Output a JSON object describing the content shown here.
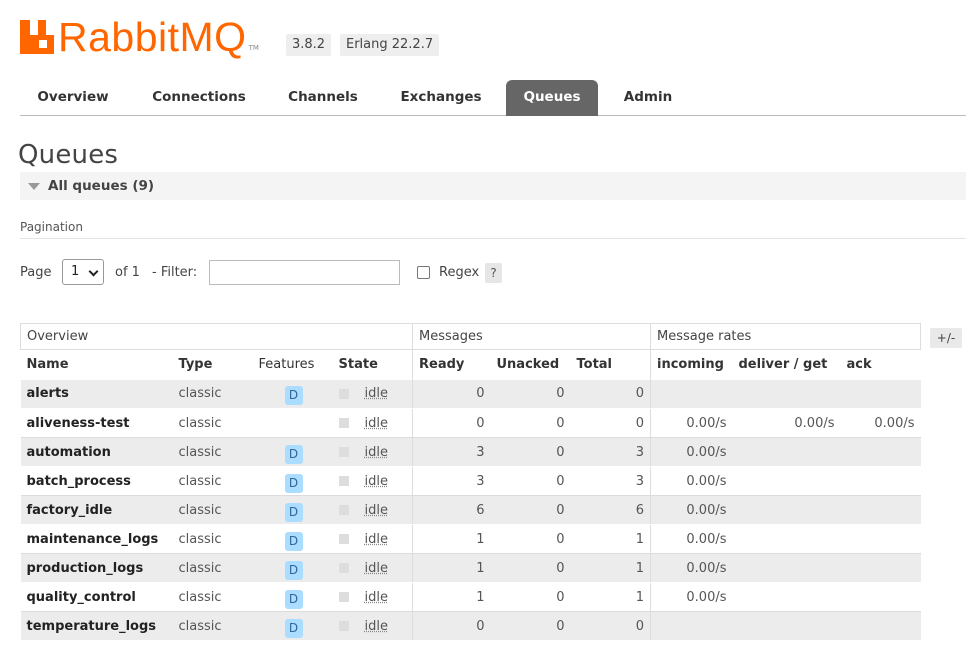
{
  "header": {
    "logo_text": "RabbitMQ",
    "logo_tm": "TM",
    "version": "3.8.2",
    "erlang": "Erlang 22.2.7"
  },
  "nav": {
    "tabs": [
      {
        "label": "Overview",
        "active": false
      },
      {
        "label": "Connections",
        "active": false
      },
      {
        "label": "Channels",
        "active": false
      },
      {
        "label": "Exchanges",
        "active": false
      },
      {
        "label": "Queues",
        "active": true
      },
      {
        "label": "Admin",
        "active": false
      }
    ]
  },
  "page": {
    "title": "Queues",
    "section_all": "All queues (9)",
    "pagination_label": "Pagination"
  },
  "controls": {
    "page_label": "Page",
    "page_value": "1",
    "of_label": "of 1",
    "filter_label": "- Filter:",
    "filter_value": "",
    "regex_label": "Regex",
    "help_label": "?",
    "columns_toggle": "+/-"
  },
  "table": {
    "groups": [
      "Overview",
      "Messages",
      "Message rates"
    ],
    "columns": [
      "Name",
      "Type",
      "Features",
      "State",
      "Ready",
      "Unacked",
      "Total",
      "incoming",
      "deliver / get",
      "ack"
    ],
    "rows": [
      {
        "name": "alerts",
        "type": "classic",
        "feature": "D",
        "state": "idle",
        "ready": "0",
        "unacked": "0",
        "total": "0",
        "incoming": "",
        "deliver": "",
        "ack": ""
      },
      {
        "name": "aliveness-test",
        "type": "classic",
        "feature": "",
        "state": "idle",
        "ready": "0",
        "unacked": "0",
        "total": "0",
        "incoming": "0.00/s",
        "deliver": "0.00/s",
        "ack": "0.00/s"
      },
      {
        "name": "automation",
        "type": "classic",
        "feature": "D",
        "state": "idle",
        "ready": "3",
        "unacked": "0",
        "total": "3",
        "incoming": "0.00/s",
        "deliver": "",
        "ack": ""
      },
      {
        "name": "batch_process",
        "type": "classic",
        "feature": "D",
        "state": "idle",
        "ready": "3",
        "unacked": "0",
        "total": "3",
        "incoming": "0.00/s",
        "deliver": "",
        "ack": ""
      },
      {
        "name": "factory_idle",
        "type": "classic",
        "feature": "D",
        "state": "idle",
        "ready": "6",
        "unacked": "0",
        "total": "6",
        "incoming": "0.00/s",
        "deliver": "",
        "ack": ""
      },
      {
        "name": "maintenance_logs",
        "type": "classic",
        "feature": "D",
        "state": "idle",
        "ready": "1",
        "unacked": "0",
        "total": "1",
        "incoming": "0.00/s",
        "deliver": "",
        "ack": ""
      },
      {
        "name": "production_logs",
        "type": "classic",
        "feature": "D",
        "state": "idle",
        "ready": "1",
        "unacked": "0",
        "total": "1",
        "incoming": "0.00/s",
        "deliver": "",
        "ack": ""
      },
      {
        "name": "quality_control",
        "type": "classic",
        "feature": "D",
        "state": "idle",
        "ready": "1",
        "unacked": "0",
        "total": "1",
        "incoming": "0.00/s",
        "deliver": "",
        "ack": ""
      },
      {
        "name": "temperature_logs",
        "type": "classic",
        "feature": "D",
        "state": "idle",
        "ready": "0",
        "unacked": "0",
        "total": "0",
        "incoming": "",
        "deliver": "",
        "ack": ""
      }
    ]
  },
  "colors": {
    "brand": "#ff6600",
    "active_tab": "#666666",
    "feature_badge": "#aaddff"
  }
}
